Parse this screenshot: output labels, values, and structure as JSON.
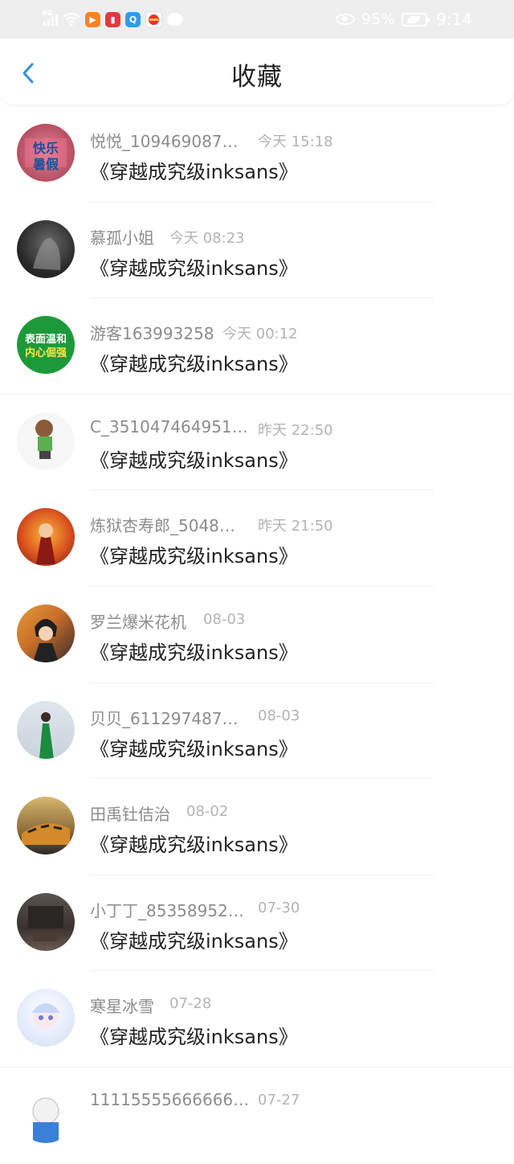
{
  "status_bar": {
    "network": "4G",
    "battery": "95%",
    "time": "9:14",
    "icons": [
      "signal-icon",
      "wifi-icon",
      "video-app-icon",
      "book-app-icon",
      "browser-app-icon",
      "reader-app-icon",
      "chat-icon"
    ]
  },
  "header": {
    "title": "收藏",
    "back_icon": "chevron-left-icon"
  },
  "items": [
    {
      "user": "悦悦_109469087…",
      "time": "今天 15:18",
      "book": "《穿越成究级inksans》",
      "avatar_text": "快乐暑假"
    },
    {
      "user": "慕孤小姐",
      "time": "今天 08:23",
      "book": "《穿越成究级inksans》"
    },
    {
      "user": "游客163993258",
      "time": "今天 00:12",
      "book": "《穿越成究级inksans》",
      "avatar_text": "表面温和内心倔强"
    },
    {
      "user": "C_351047464951…",
      "time": "昨天 22:50",
      "book": "《穿越成究级inksans》"
    },
    {
      "user": "炼狱杏寿郎_5048…",
      "time": "昨天 21:50",
      "book": "《穿越成究级inksans》"
    },
    {
      "user": "罗兰爆米花机",
      "time": "08-03",
      "book": "《穿越成究级inksans》"
    },
    {
      "user": "贝贝_611297487…",
      "time": "08-03",
      "book": "《穿越成究级inksans》"
    },
    {
      "user": "田禹钍佶治",
      "time": "08-02",
      "book": "《穿越成究级inksans》"
    },
    {
      "user": "小丁丁_85358952…",
      "time": "07-30",
      "book": "《穿越成究级inksans》"
    },
    {
      "user": "寒星冰雪",
      "time": "07-28",
      "book": "《穿越成究级inksans》"
    },
    {
      "user": "11115555666666…",
      "time": "07-27",
      "book": ""
    }
  ],
  "colors": {
    "accent": "#2f8fe0",
    "status_bar_bg": "#eeeeef",
    "username": "#8c8c8c",
    "time": "#b3b3b3"
  }
}
